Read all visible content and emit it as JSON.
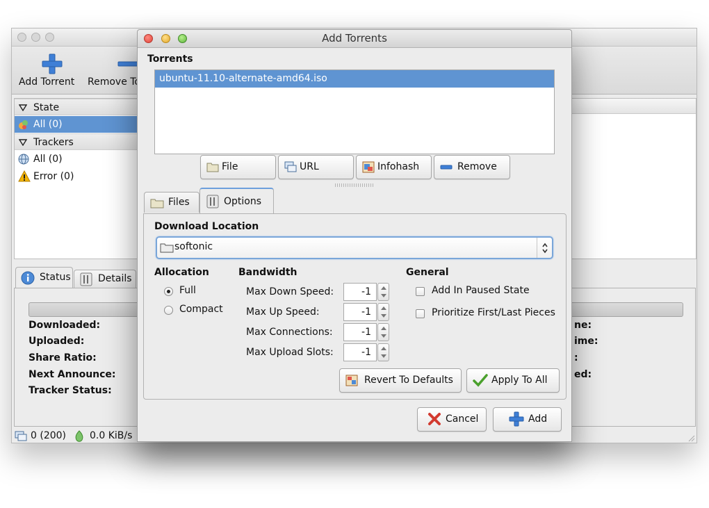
{
  "main_window": {
    "toolbar": {
      "add_torrent": "Add Torrent",
      "remove_torrent": "Remove To"
    },
    "sidebar": {
      "state_header": "State",
      "state_all": "All (0)",
      "trackers_header": "Trackers",
      "trackers_all": "All (0)",
      "trackers_error": "Error (0)"
    },
    "tabs": {
      "status": "Status",
      "details": "Details"
    },
    "status_fields": {
      "downloaded": "Downloaded:",
      "uploaded": "Uploaded:",
      "share_ratio": "Share Ratio:",
      "next_announce": "Next Announce:",
      "tracker_status": "Tracker Status:"
    },
    "right_fields": {
      "f1": "ne:",
      "f2": "ime:",
      "f3": ":",
      "f4": "ed:"
    },
    "statusbar": {
      "connections": "0 (200)",
      "down_speed": "0.0 KiB/s"
    }
  },
  "dialog": {
    "title": "Add Torrents",
    "torrents_label": "Torrents",
    "torrent_items": [
      "ubuntu-11.10-alternate-amd64.iso"
    ],
    "buttons": {
      "file": "File",
      "url": "URL",
      "infohash": "Infohash",
      "remove": "Remove"
    },
    "tabs": {
      "files": "Files",
      "options": "Options"
    },
    "download_location_label": "Download Location",
    "download_location_value": "softonic",
    "allocation": {
      "label": "Allocation",
      "full": "Full",
      "compact": "Compact",
      "selected": "Full"
    },
    "bandwidth": {
      "label": "Bandwidth",
      "max_down_label": "Max Down Speed:",
      "max_down_value": "-1",
      "max_up_label": "Max Up Speed:",
      "max_up_value": "-1",
      "max_conn_label": "Max Connections:",
      "max_conn_value": "-1",
      "max_slots_label": "Max Upload Slots:",
      "max_slots_value": "-1"
    },
    "general": {
      "label": "General",
      "add_paused": "Add In Paused State",
      "prioritize": "Prioritize First/Last Pieces"
    },
    "revert_button": "Revert To Defaults",
    "apply_all_button": "Apply To All",
    "cancel_button": "Cancel",
    "add_button": "Add"
  },
  "colors": {
    "selection": "#5f94d2",
    "add_plus": "#3f7fd6",
    "cancel_x": "#d23a2f",
    "apply_check": "#4aa02c"
  }
}
